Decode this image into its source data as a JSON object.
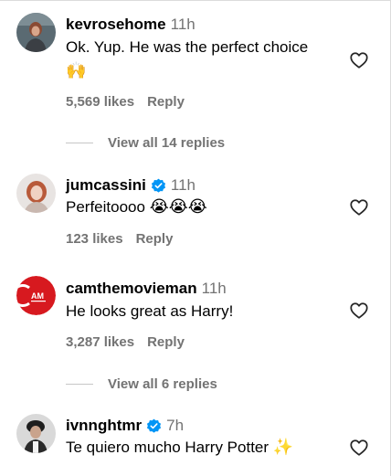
{
  "comments": [
    {
      "username": "kevrosehome",
      "verified": false,
      "time": "11h",
      "text": "Ok. Yup. He was the perfect choice",
      "emoji": "🙌",
      "likes": "5,569 likes",
      "reply_label": "Reply",
      "view_replies": "View all 14 replies"
    },
    {
      "username": "jumcassini",
      "verified": true,
      "time": "11h",
      "text": "Perfeitoooo",
      "emoji": "😭😭😭",
      "likes": "123 likes",
      "reply_label": "Reply"
    },
    {
      "username": "camthemovieman",
      "verified": false,
      "time": "11h",
      "text": "He looks great as Harry!",
      "likes": "3,287 likes",
      "reply_label": "Reply",
      "view_replies": "View all 6 replies",
      "avatar_text": "AM"
    },
    {
      "username": "ivnnghtmr",
      "verified": true,
      "time": "7h",
      "text": "Te quiero mucho Harry Potter",
      "emoji": "✨"
    }
  ],
  "colors": {
    "secondary_text": "#737373",
    "verified_blue": "#0095f6",
    "heart_stroke": "#262626",
    "cam_avatar_red": "#d7191f"
  },
  "icons": {
    "like": "heart-outline-icon",
    "verified": "verified-badge-icon"
  }
}
